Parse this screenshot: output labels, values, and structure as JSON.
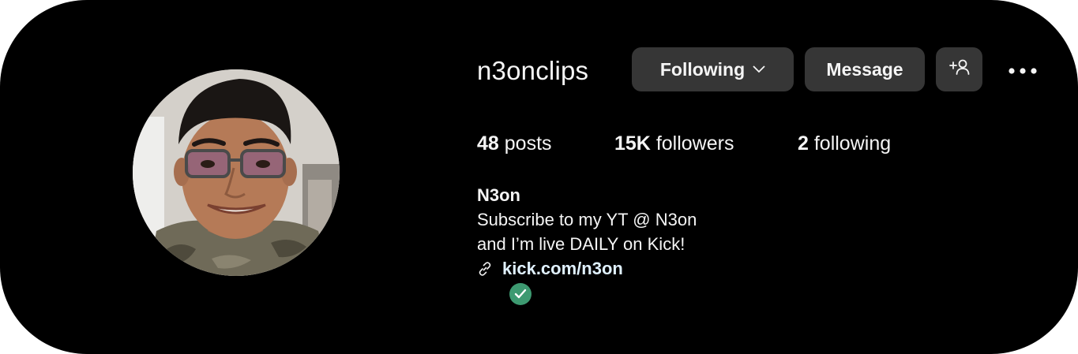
{
  "profile": {
    "username": "n3onclips",
    "full_name": "N3on",
    "bio_lines": [
      "Subscribe to my YT @ N3on",
      "and I’m live DAILY on Kick!"
    ],
    "link": "kick.com/n3on"
  },
  "actions": {
    "following_label": "Following",
    "message_label": "Message"
  },
  "stats": {
    "posts_count": "48",
    "posts_label": " posts",
    "followers_count": "15K",
    "followers_label": " followers",
    "following_count": "2",
    "following_label": " following"
  },
  "colors": {
    "background": "#000000",
    "button": "#363636",
    "text": "#f5f5f5",
    "link": "#e0f1ff",
    "verified_badge": "#3d9a71"
  },
  "icons": {
    "following_dropdown": "chevron-down-icon",
    "suggest": "add-person-icon",
    "more": "more-options-icon",
    "link": "link-icon",
    "badge": "check-icon"
  }
}
